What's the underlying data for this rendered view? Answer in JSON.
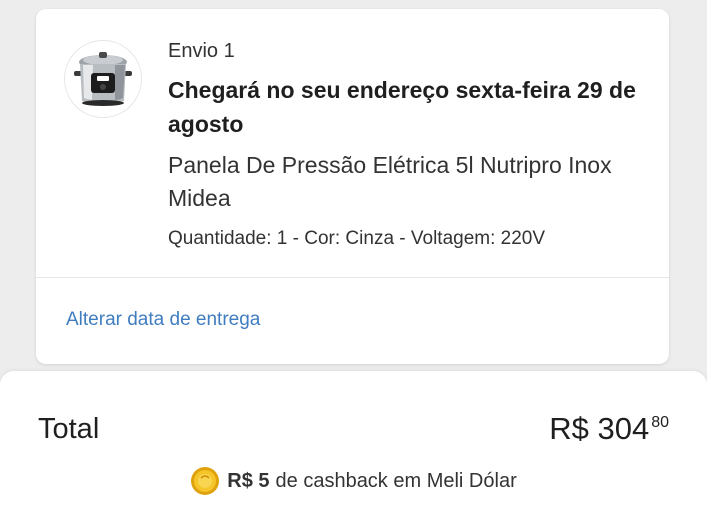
{
  "shipment": {
    "label": "Envio 1",
    "arrival": "Chegará no seu endereço sexta-feira 29 de agosto",
    "product_name": "Panela De Pressão Elétrica 5l Nutripro Inox Midea",
    "product_attributes": "Quantidade: 1 - Cor: Cinza - Voltagem: 220V",
    "change_date_link": "Alterar data de entrega",
    "thumbnail_icon": "pressure-cooker-icon"
  },
  "summary": {
    "total_label": "Total",
    "total_price_int": "R$ 304",
    "total_price_cents": "80",
    "cashback_amount": "R$ 5",
    "cashback_text": "de cashback em Meli Dólar",
    "cashback_icon": "meli-dolar-coin-icon"
  },
  "colors": {
    "link": "#3f7dc0",
    "background": "#ededed",
    "card": "#ffffff",
    "coin": "#f2b614"
  }
}
